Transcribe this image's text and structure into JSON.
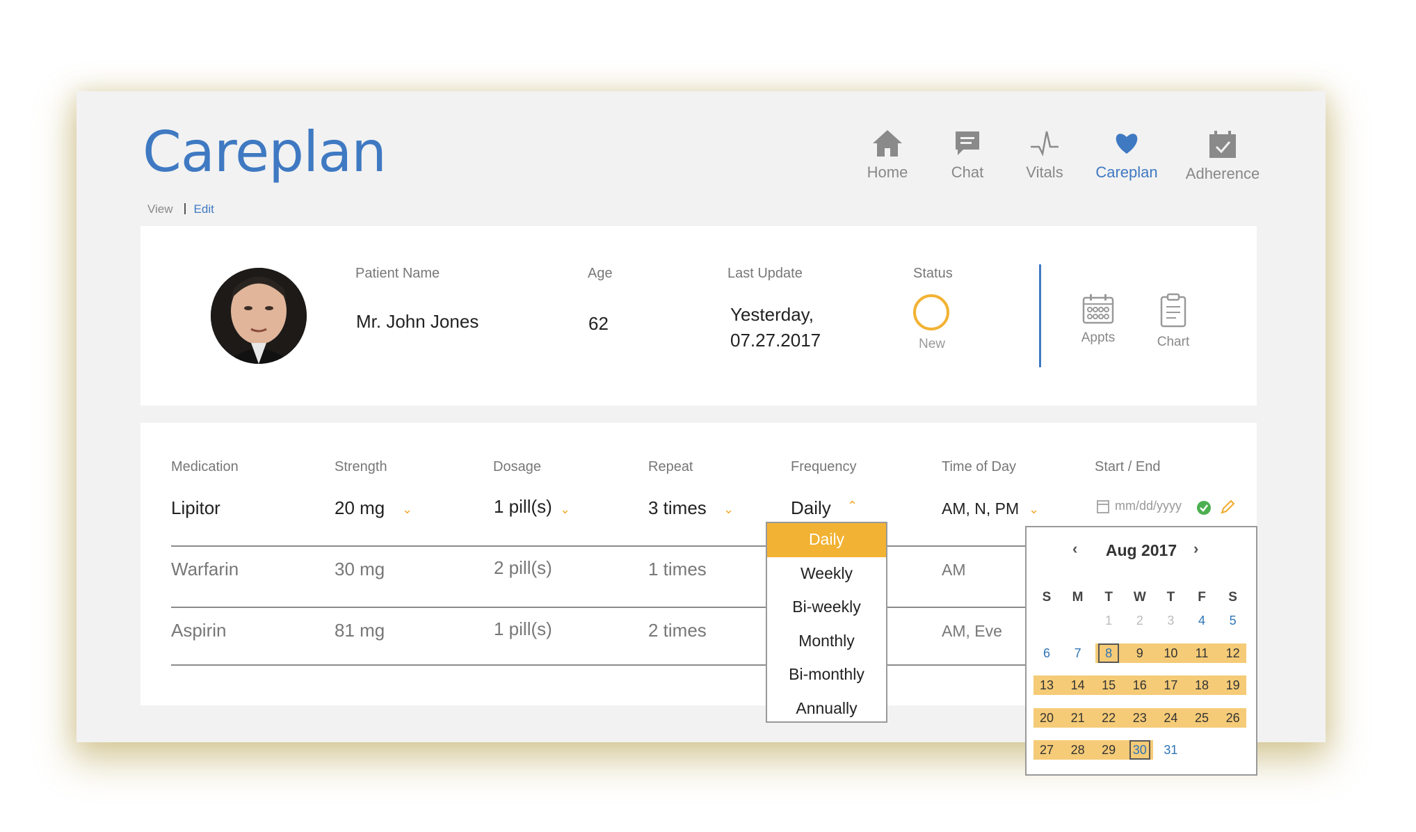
{
  "page": {
    "title": "Careplan"
  },
  "mode": {
    "view": "View",
    "edit": "Edit"
  },
  "nav": [
    {
      "label": "Home",
      "icon": "home-icon"
    },
    {
      "label": "Chat",
      "icon": "chat-icon"
    },
    {
      "label": "Vitals",
      "icon": "vitals-icon"
    },
    {
      "label": "Careplan",
      "icon": "heart-icon",
      "active": true
    },
    {
      "label": "Adherence",
      "icon": "calendar-check-icon"
    }
  ],
  "patient": {
    "name_label": "Patient Name",
    "name": "Mr. John Jones",
    "age_label": "Age",
    "age": "62",
    "update_label": "Last Update",
    "update_line1": "Yesterday,",
    "update_line2": "07.27.2017",
    "status_label": "Status",
    "status": "New"
  },
  "quick_actions": [
    {
      "label": "Appts"
    },
    {
      "label": "Chart"
    }
  ],
  "med_table": {
    "headers": [
      "Medication",
      "Strength",
      "Dosage",
      "Repeat",
      "Frequency",
      "Time of Day",
      "Start / End"
    ],
    "rows": [
      {
        "medication": "Lipitor",
        "strength": "20 mg",
        "dosage": "1 pill(s)",
        "repeat": "3 times",
        "frequency": "Daily",
        "time": "AM, N, PM",
        "date_placeholder": "mm/dd/yyyy"
      },
      {
        "medication": "Warfarin",
        "strength": "30 mg",
        "dosage": "2 pill(s)",
        "repeat": "1 times",
        "frequency": "",
        "time": "AM"
      },
      {
        "medication": "Aspirin",
        "strength": "81 mg",
        "dosage": "1 pill(s)",
        "repeat": "2 times",
        "frequency": "",
        "time": "AM, Eve"
      }
    ]
  },
  "frequency_dropdown": {
    "options": [
      "Daily",
      "Weekly",
      "Bi-weekly",
      "Monthly",
      "Bi-monthly",
      "Annually"
    ],
    "selected": "Daily"
  },
  "calendar": {
    "month": "Aug 2017",
    "weekdays": [
      "S",
      "M",
      "T",
      "W",
      "T",
      "F",
      "S"
    ],
    "prev_days": [
      "1",
      "2",
      "3"
    ],
    "start_day": "8",
    "end_day": "30"
  },
  "colors": {
    "accent": "#3f79c2",
    "highlight": "#f2b233",
    "range": "#f5cb77",
    "status_ring": "#f2b233"
  }
}
